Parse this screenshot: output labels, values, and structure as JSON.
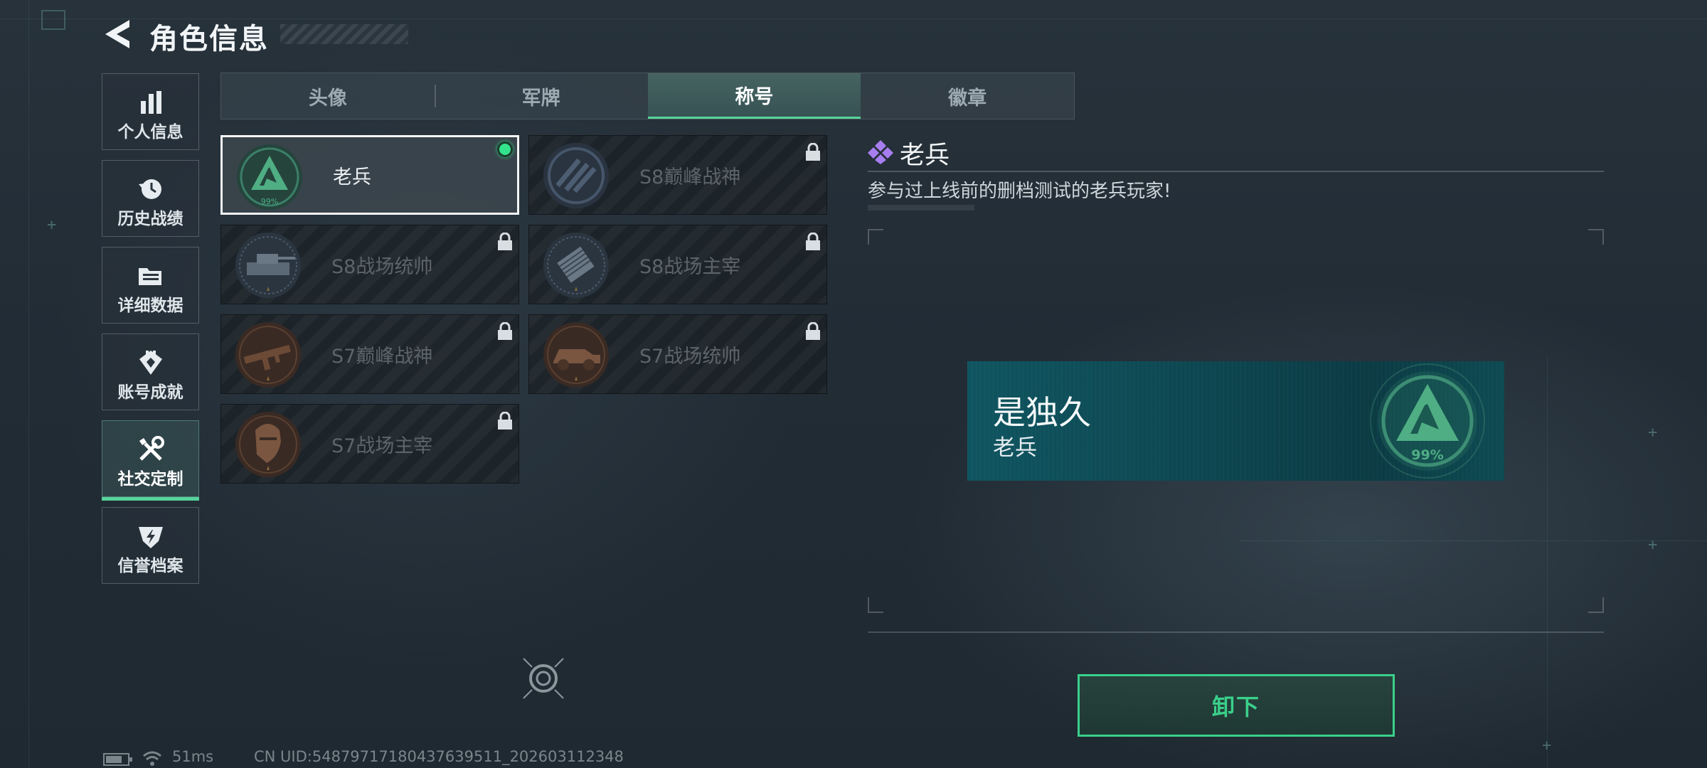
{
  "header": {
    "title": "角色信息"
  },
  "sidebar": {
    "items": [
      {
        "label": "个人信息",
        "icon": "bar-chart-icon",
        "active": false
      },
      {
        "label": "历史战绩",
        "icon": "history-clock-icon",
        "active": false
      },
      {
        "label": "详细数据",
        "icon": "folder-icon",
        "active": false
      },
      {
        "label": "账号成就",
        "icon": "achievement-icon",
        "active": false
      },
      {
        "label": "社交定制",
        "icon": "tools-icon",
        "active": true
      },
      {
        "label": "信誉档案",
        "icon": "credit-shield-icon",
        "active": false
      }
    ]
  },
  "tabs": [
    {
      "label": "头像",
      "active": false
    },
    {
      "label": "军牌",
      "active": false
    },
    {
      "label": "称号",
      "active": true
    },
    {
      "label": "徽章",
      "active": false
    }
  ],
  "titles": [
    {
      "name": "老兵",
      "locked": false,
      "selected": true,
      "equipped": true,
      "emblem": "veteran-emblem",
      "emblem_text": "99%"
    },
    {
      "name": "S8巅峰战神",
      "locked": true,
      "selected": false,
      "emblem": "s8-peak-emblem"
    },
    {
      "name": "S8战场统帅",
      "locked": true,
      "selected": false,
      "emblem": "s8-tank-emblem"
    },
    {
      "name": "S8战场主宰",
      "locked": true,
      "selected": false,
      "emblem": "s8-rocket-emblem"
    },
    {
      "name": "S7巅峰战神",
      "locked": true,
      "selected": false,
      "emblem": "s7-rifle-emblem"
    },
    {
      "name": "S7战场统帅",
      "locked": true,
      "selected": false,
      "emblem": "s7-vehicle-emblem"
    },
    {
      "name": "S7战场主宰",
      "locked": true,
      "selected": false,
      "emblem": "s7-soldier-emblem"
    }
  ],
  "detail": {
    "name": "老兵",
    "description": "参与过上线前的删档测试的老兵玩家!"
  },
  "preview": {
    "player_name": "是独久",
    "title": "老兵",
    "emblem_text": "99%"
  },
  "actions": {
    "unequip_label": "卸下"
  },
  "status_bar": {
    "ping": "51ms",
    "uid": "CN UID:5487971718043763951​1_202603112348"
  },
  "colors": {
    "accent": "#57d39a",
    "equipped_dot": "#33e38c",
    "banner": "#0f5560"
  }
}
